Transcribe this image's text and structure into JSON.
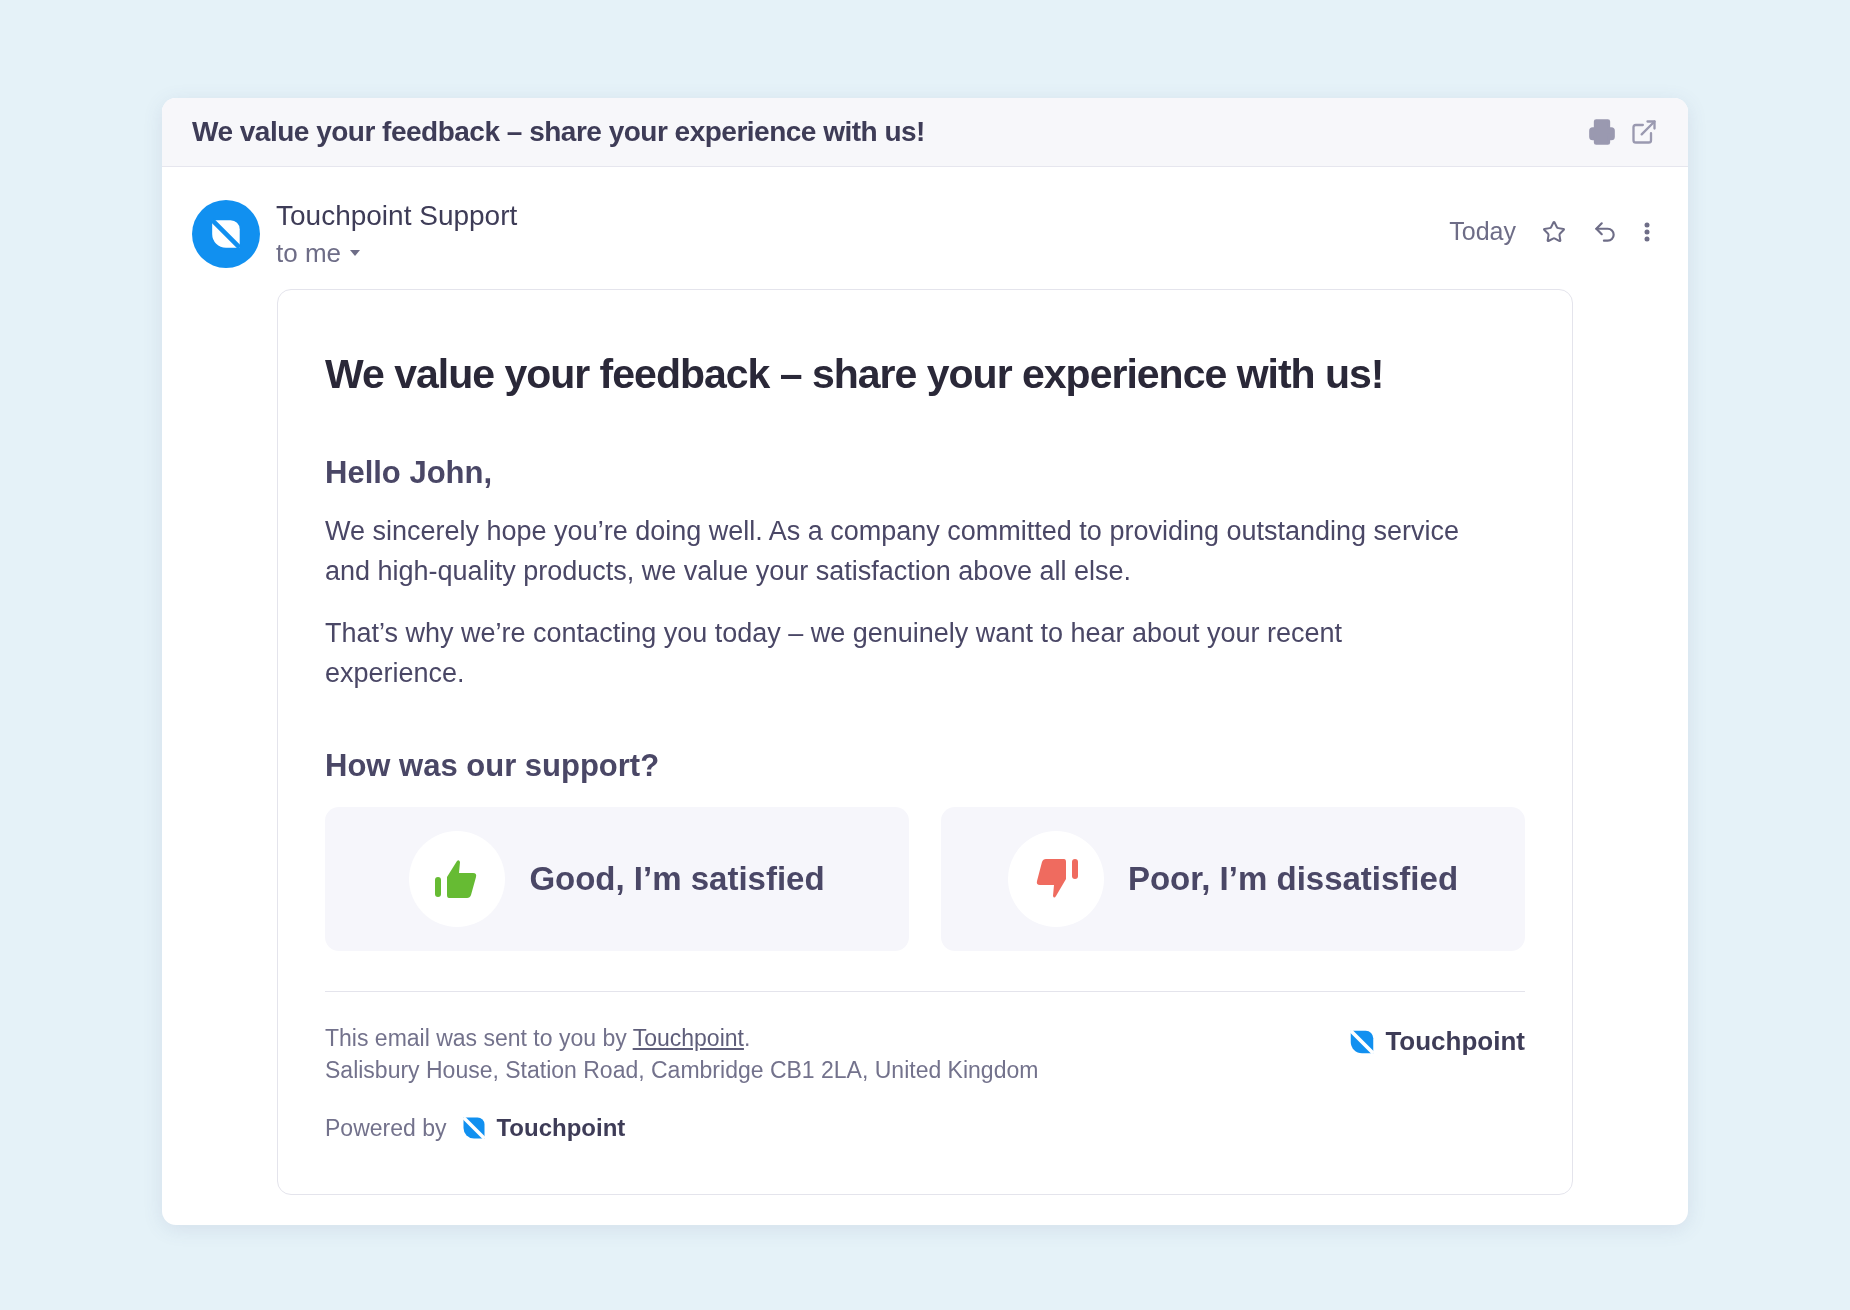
{
  "window": {
    "title": "We value your feedback – share your experience with us!"
  },
  "sender": {
    "name": "Touchpoint Support",
    "recipient": "to me",
    "date": "Today",
    "starred": false
  },
  "email": {
    "heading": "We value your feedback – share your experience with us!",
    "greeting": "Hello John,",
    "paragraphs": [
      "We sincerely hope you’re doing well. As a company committed to providing outstanding service and high-quality products, we value your satisfaction above all else.",
      "That’s why we’re contacting you today – we genuinely want to hear about your recent experience."
    ],
    "question": "How was our support?",
    "options": [
      {
        "kind": "good",
        "label": "Good, I’m satisfied"
      },
      {
        "kind": "poor",
        "label": "Poor, I’m dissatisfied"
      }
    ],
    "footer": {
      "sent_by": "This email was sent to you by",
      "link": "Touchpoint",
      "link_suffix": ".",
      "address": "Salisbury House, Station Road, Cambridge CB1 2LA, United Kingdom",
      "brand": "Touchpoint",
      "powered_by": "Powered by",
      "powered_brand": "Touchpoint"
    }
  }
}
